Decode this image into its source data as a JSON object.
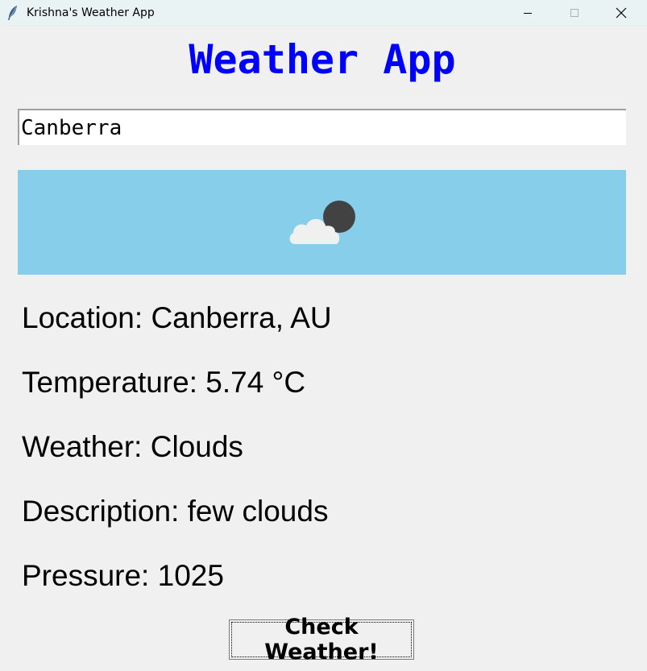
{
  "window": {
    "title": "Krishna's Weather App",
    "app_icon": "feather-icon",
    "controls": {
      "minimize": "minimize-icon",
      "maximize": "maximize-icon",
      "close": "close-icon"
    }
  },
  "heading": "Weather App",
  "search": {
    "value": "Canberra"
  },
  "icon_panel": {
    "icon": "few-clouds-night-icon",
    "background": "#87ceeb"
  },
  "info": {
    "location": "Location: Canberra, AU",
    "temperature": "Temperature: 5.74 °C",
    "weather": "Weather: Clouds",
    "description": "Description: few clouds",
    "pressure": "Pressure: 1025"
  },
  "button": {
    "label": "Check Weather!"
  },
  "colors": {
    "heading": "#0000ff",
    "panel": "#87ceeb",
    "window_bg": "#f0f0f0"
  }
}
